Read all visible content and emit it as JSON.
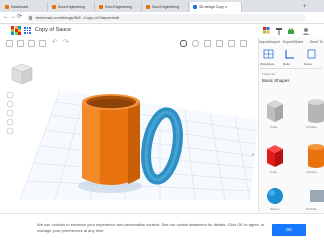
{
  "browser": {
    "tabs": [
      {
        "label": "Dashboard"
      },
      {
        "label": "Sora Engineering"
      },
      {
        "label": "Sora Engineering"
      },
      {
        "label": "Sora Engineering"
      },
      {
        "label": "3D design Copy o"
      }
    ],
    "new_tab_label": "+",
    "url": "tinkercad.com/things/3h9...Copy-of-Saucer/edit"
  },
  "app": {
    "doc_title": "Copy of Sauce"
  },
  "panel": {
    "top_labels": [
      "Import/Import",
      "Export/Share",
      "Send To"
    ],
    "nav_labels": [
      "Workplane",
      "Ruler",
      "Notes"
    ],
    "category_label": "Tinkercad",
    "category_value": "Basic Shapes",
    "shapes": [
      {
        "label": "Cube"
      },
      {
        "label": "Cylinder"
      },
      {
        "label": "Cube"
      },
      {
        "label": "Cylinder"
      },
      {
        "label": "Sphere"
      },
      {
        "label": "Scribble"
      }
    ]
  },
  "cookie": {
    "text": "We use cookies to enhance your experience and personalize content. See our cookie statement for details. Click OK to agree, or manage your preferences at any time.",
    "ok_label": "OK"
  },
  "colors": {
    "mug": "#e8730e",
    "handle": "#2d8fc4",
    "accent": "#1677ff"
  }
}
